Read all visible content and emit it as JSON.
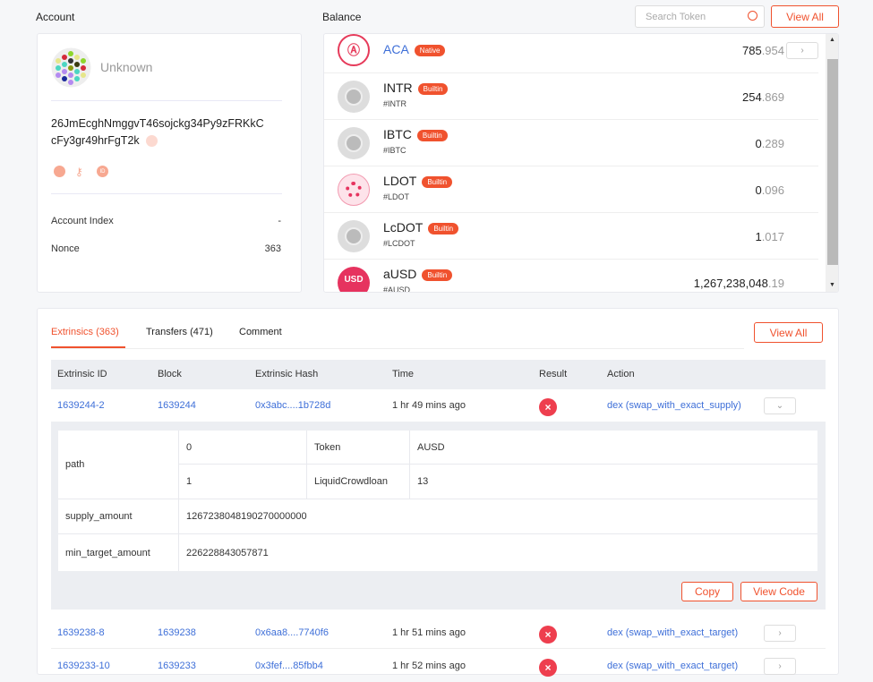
{
  "account": {
    "section_title": "Account",
    "name": "Unknown",
    "address": "26JmEcghNmggvT46sojckg34Py9zFRKkCcFy3gr49hrFgT2k",
    "address_line1": "26JmEcghNmggvT46sojckg34Py9zFRKkC",
    "address_line2": "cFy3gr49hrFgT2k",
    "account_index_label": "Account Index",
    "account_index_value": "-",
    "nonce_label": "Nonce",
    "nonce_value": "363"
  },
  "balance": {
    "section_title": "Balance",
    "search_placeholder": "Search Token",
    "view_all": "View All",
    "tokens": [
      {
        "name": "ACA",
        "badge": "Native",
        "symbol": "",
        "int": "785",
        "dec": ".954"
      },
      {
        "name": "INTR",
        "badge": "Builtin",
        "symbol": "#INTR",
        "int": "254",
        "dec": ".869"
      },
      {
        "name": "IBTC",
        "badge": "Builtin",
        "symbol": "#IBTC",
        "int": "0",
        "dec": ".289"
      },
      {
        "name": "LDOT",
        "badge": "Builtin",
        "symbol": "#LDOT",
        "int": "0",
        "dec": ".096"
      },
      {
        "name": "LcDOT",
        "badge": "Builtin",
        "symbol": "#LCDOT",
        "int": "1",
        "dec": ".017"
      },
      {
        "name": "aUSD",
        "badge": "Builtin",
        "symbol": "#AUSD",
        "int": "1,267,238,048",
        "dec": ".19",
        "icon_text": "USD"
      }
    ]
  },
  "tabs": [
    {
      "label": "Extrinsics (363)"
    },
    {
      "label": "Transfers (471)"
    },
    {
      "label": "Comment"
    }
  ],
  "view_all": "View All",
  "table": {
    "headers": [
      "Extrinsic ID",
      "Block",
      "Extrinsic Hash",
      "Time",
      "Result",
      "Action"
    ],
    "rows": [
      {
        "id": "1639244-2",
        "block": "1639244",
        "hash": "0x3abc....1b728d",
        "time": "1 hr 49 mins ago",
        "action": "dex (swap_with_exact_supply)"
      },
      {
        "id": "1639238-8",
        "block": "1639238",
        "hash": "0x6aa8....7740f6",
        "time": "1 hr 51 mins ago",
        "action": "dex (swap_with_exact_target)"
      },
      {
        "id": "1639233-10",
        "block": "1639233",
        "hash": "0x3fef....85fbb4",
        "time": "1 hr 52 mins ago",
        "action": "dex (swap_with_exact_target)"
      }
    ]
  },
  "detail": {
    "path_label": "path",
    "path": [
      {
        "index": "0",
        "key": "Token",
        "value": "AUSD"
      },
      {
        "index": "1",
        "key": "LiquidCrowdloan",
        "value": "13"
      }
    ],
    "supply_label": "supply_amount",
    "supply_value": "1267238048190270000000",
    "min_label": "min_target_amount",
    "min_value": "226228843057871",
    "copy": "Copy",
    "view_code": "View Code"
  },
  "colors": {
    "accent": "#f0522e",
    "link": "#3e6fd8",
    "error": "#ee3e4e"
  }
}
